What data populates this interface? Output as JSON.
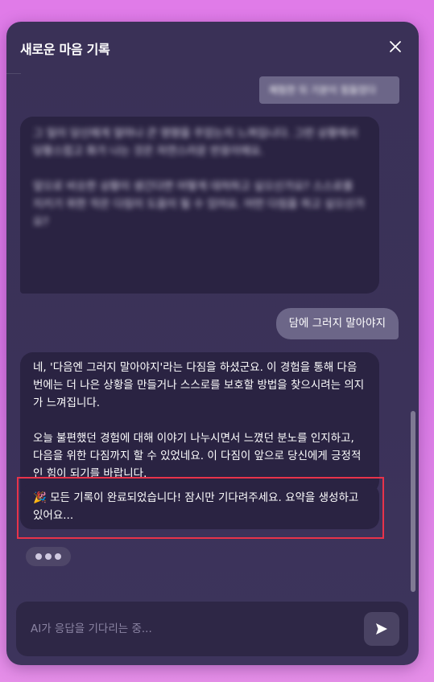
{
  "modal": {
    "title": "새로운 마음 기록"
  },
  "messages": {
    "user_1": "체험한 뒤 기분이 힘들었다",
    "ai_1_p1": "그 일이 당신에게 얼마나 큰 영향을 주었는지 느껴집니다. 그런 상황에서 당황스럽고 화가 나는 것은 자연스러운 반응이에요.",
    "ai_1_p2": "앞으로 비슷한 상황이 생긴다면 어떻게 대처하고 싶으신가요? 스스로를 지키기 위한 작은 다짐이 도움이 될 수 있어요. 어떤 다짐을 하고 싶으신가요?",
    "user_2": "담에 그러지 말아야지",
    "ai_2_p1": "네, '다음엔 그러지 말아야지'라는 다짐을 하셨군요. 이 경험을 통해 다음번에는 더 나은 상황을 만들거나 스스로를 보호할 방법을 찾으시려는 의지가 느껴집니다.",
    "ai_2_p2": "오늘 불편했던 경험에 대해 이야기 나누시면서 느꼈던 분노를 인지하고, 다음을 위한 다짐까지 할 수 있었네요. 이 다짐이 앞으로 당신에게 긍정적인 힘이 되기를 바랍니다.",
    "status": "🎉 모든 기록이 완료되었습니다! 잠시만 기다려주세요. 요약을 생성하고 있어요..."
  },
  "composer": {
    "placeholder": "AI가 응답을 기다리는 중..."
  },
  "icons": {
    "close": "close-icon",
    "send": "send-icon",
    "typing": "typing-indicator"
  },
  "colors": {
    "background": "#e07be8",
    "modal": "#3a3157",
    "user_bubble": "#6c6688",
    "ai_bubble": "#2a2342",
    "highlight_border": "#e8334a"
  }
}
